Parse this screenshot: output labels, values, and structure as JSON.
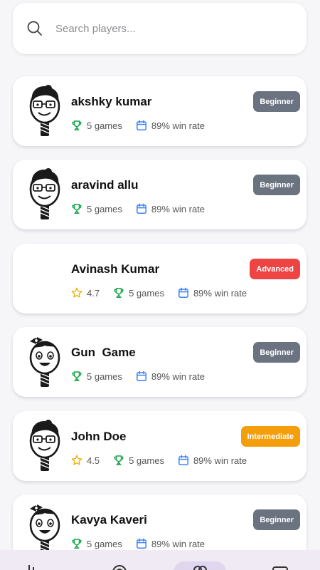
{
  "search": {
    "placeholder": "Search players..."
  },
  "players": [
    {
      "name": "akshky kumar",
      "level": "Beginner",
      "level_color": "#6b7280",
      "games": "5 games",
      "win_rate": "89% win rate",
      "avatar": "paddle-face-icon"
    },
    {
      "name": "aravind allu",
      "level": "Beginner",
      "level_color": "#6b7280",
      "games": "5 games",
      "win_rate": "89% win rate",
      "avatar": "paddle-face-icon"
    },
    {
      "name": "Avinash Kumar",
      "level": "Advanced",
      "level_color": "#ef4444",
      "rating": "4.7",
      "games": "5 games",
      "win_rate": "89% win rate"
    },
    {
      "name": "Gun  Game",
      "level": "Beginner",
      "level_color": "#6b7280",
      "games": "5 games",
      "win_rate": "89% win rate",
      "avatar": "paddle-face-bow-icon"
    },
    {
      "name": "John Doe",
      "level": "Intermediate",
      "level_color": "#f59e0b",
      "rating": "4.5",
      "games": "5 games",
      "win_rate": "89% win rate",
      "avatar": "paddle-face-icon"
    },
    {
      "name": "Kavya Kaveri",
      "level": "Beginner",
      "level_color": "#6b7280",
      "games": "5 games",
      "win_rate": "89% win rate",
      "avatar": "paddle-face-bow-icon"
    }
  ],
  "colors": {
    "trophy": "#16a34a",
    "calendar": "#3b82f6",
    "star": "#eab308",
    "nav_background": "#efeaf4",
    "nav_active": "#e0d6ee"
  },
  "bottom_nav": {
    "items": [
      {
        "icon": "chart-icon",
        "active": false
      },
      {
        "icon": "target-icon",
        "active": false
      },
      {
        "icon": "users-icon",
        "active": true
      },
      {
        "icon": "message-icon",
        "active": false
      }
    ]
  }
}
